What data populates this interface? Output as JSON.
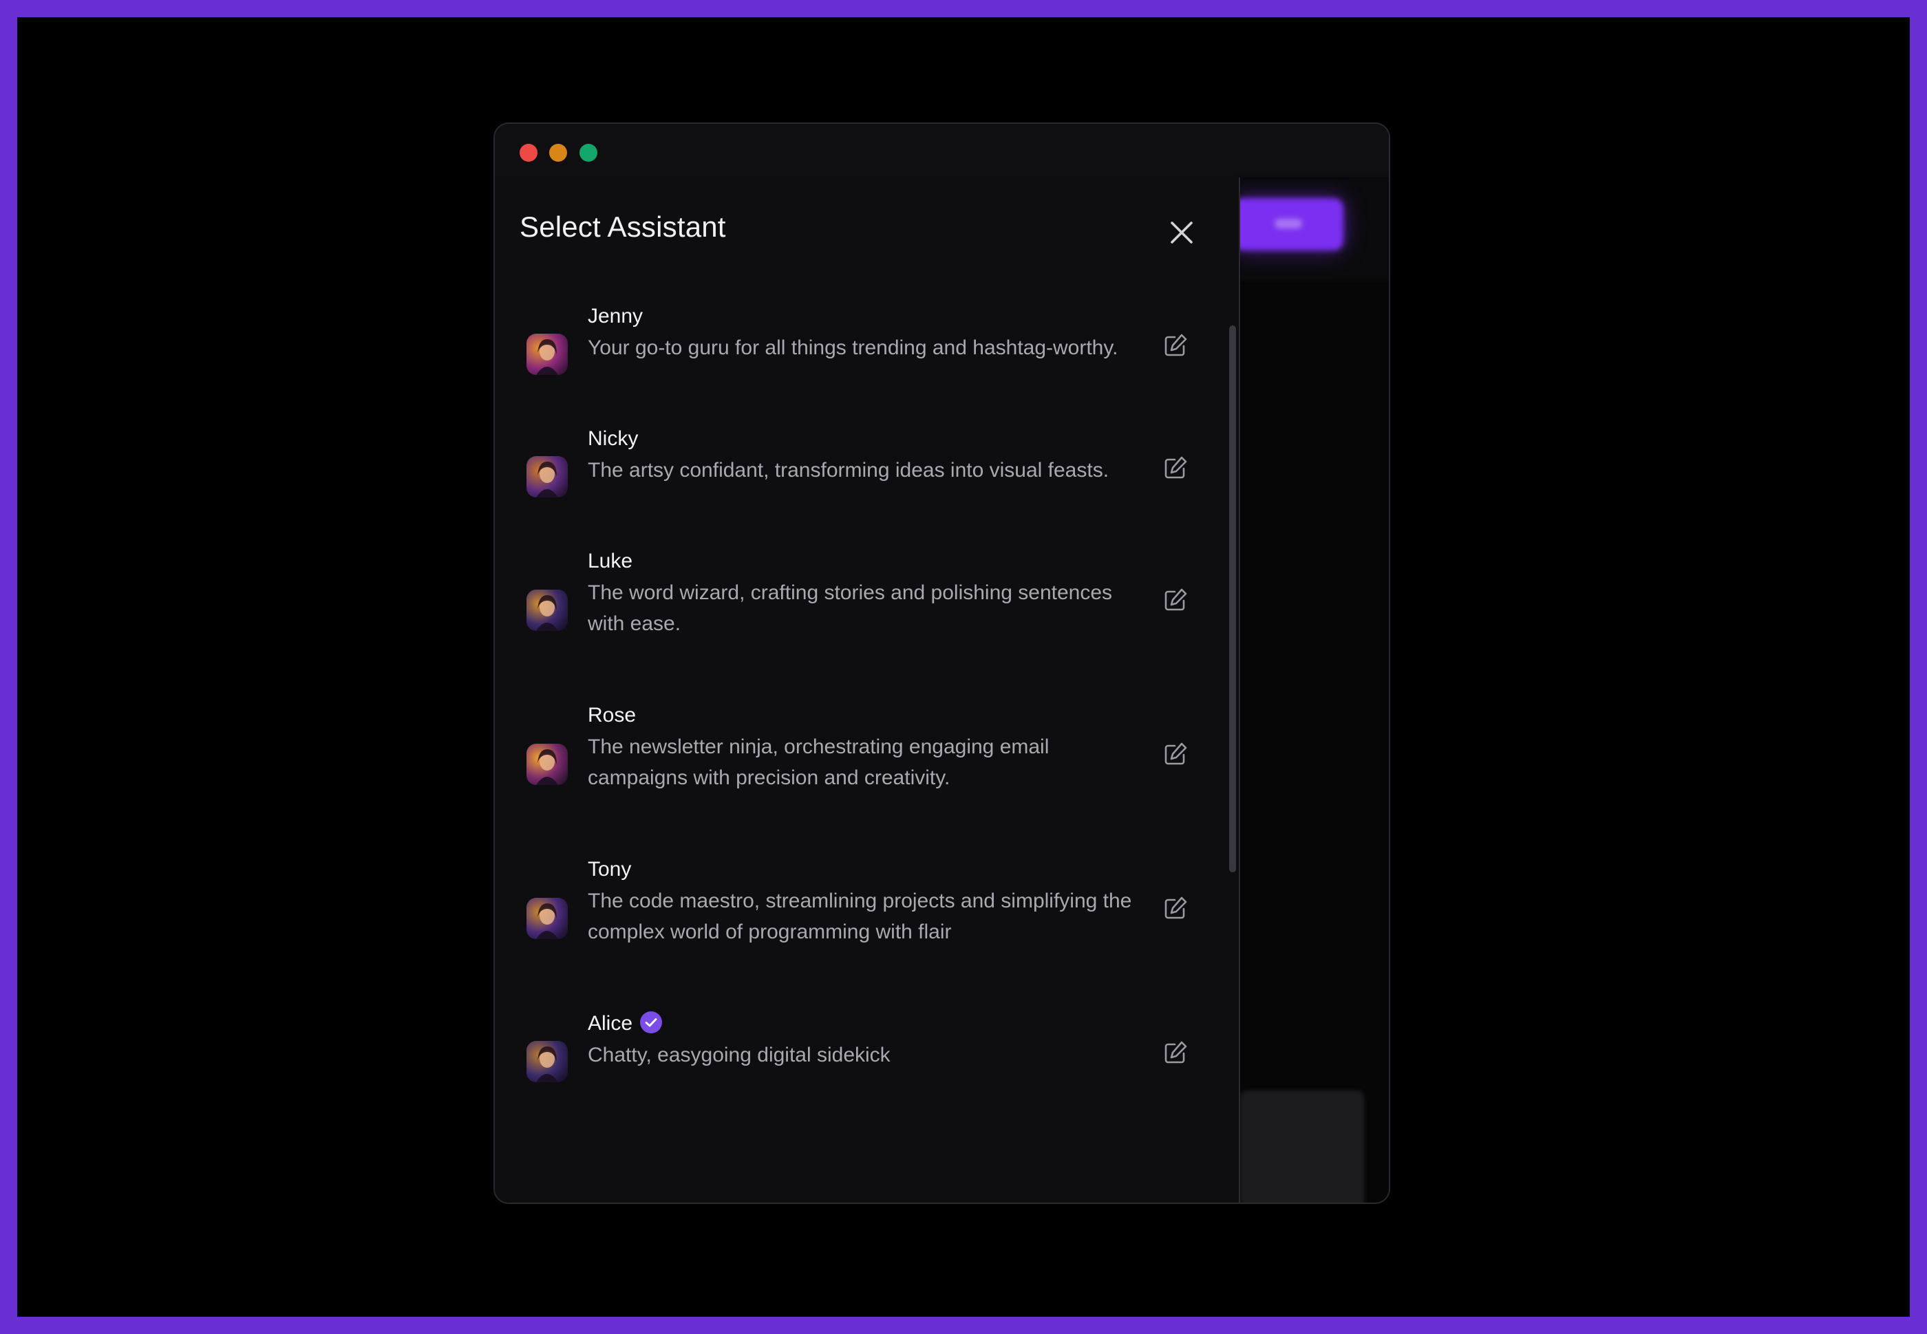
{
  "modal": {
    "title": "Select Assistant",
    "close_icon": "close-icon"
  },
  "assistants": [
    {
      "name": "Jenny",
      "description": "Your go-to guru for all things trending and hashtag-worthy.",
      "verified": false,
      "colors": [
        "#e7922b",
        "#8a2a7a",
        "#2a1030"
      ]
    },
    {
      "name": "Nicky",
      "description": "The artsy confidant, transforming ideas into visual feasts.",
      "verified": false,
      "colors": [
        "#c9772a",
        "#5b2c7c",
        "#1a0f28"
      ]
    },
    {
      "name": "Luke",
      "description": "The word wizard, crafting stories and polishing sentences with ease.",
      "verified": false,
      "colors": [
        "#d38c2b",
        "#3b2a6a",
        "#120d20"
      ]
    },
    {
      "name": "Rose",
      "description": "The newsletter ninja, orchestrating engaging email campaigns with precision and creativity.",
      "verified": false,
      "colors": [
        "#f0a030",
        "#7a2a6a",
        "#20102a"
      ]
    },
    {
      "name": "Tony",
      "description": "The code maestro, streamlining projects and simplifying the complex world of programming with flair",
      "verified": false,
      "colors": [
        "#c8862a",
        "#4a2a7a",
        "#140e22"
      ]
    },
    {
      "name": "Alice",
      "description": "Chatty, easygoing digital sidekick",
      "verified": true,
      "colors": [
        "#b77a30",
        "#3a2a6a",
        "#120e22"
      ]
    }
  ],
  "icons": {
    "edit": "edit-icon",
    "verified": "verified-badge-icon"
  },
  "accent": "#7b4de8"
}
